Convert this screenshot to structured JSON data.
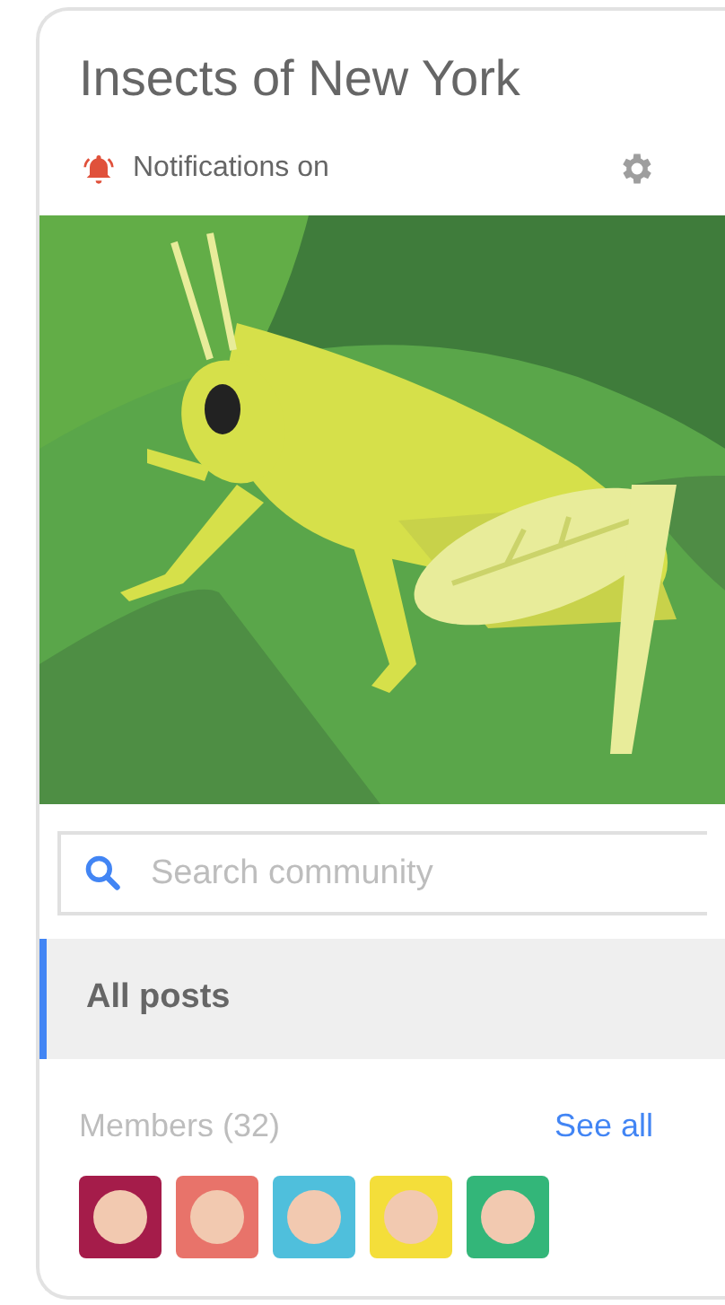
{
  "community": {
    "title": "Insects of New York"
  },
  "notifications": {
    "label": "Notifications on",
    "on": true
  },
  "search": {
    "placeholder": "Search community"
  },
  "nav": [
    {
      "label": "All posts",
      "selected": true
    }
  ],
  "members": {
    "label": "Members (32)",
    "link": "See all",
    "avatars": [
      {
        "color": "#a51c4a"
      },
      {
        "color": "#e8736a"
      },
      {
        "color": "#4fbfdc"
      },
      {
        "color": "#f4de3a"
      },
      {
        "color": "#33b679"
      }
    ]
  }
}
